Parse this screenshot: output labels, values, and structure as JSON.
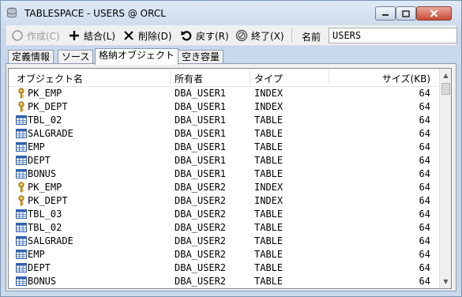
{
  "window": {
    "title": "TABLESPACE - USERS @ ORCL"
  },
  "toolbar": {
    "create_label": "作成(C)",
    "merge_label": "結合(L)",
    "delete_label": "削除(D)",
    "back_label": "戻す(R)",
    "exit_label": "終了(X)",
    "name_label": "名前",
    "name_value": "USERS"
  },
  "tabs": [
    {
      "label": "定義情報"
    },
    {
      "label": "ソース"
    },
    {
      "label": "格納オブジェクト"
    },
    {
      "label": "空き容量"
    }
  ],
  "columns": {
    "object_name": "オブジェクト名",
    "owner": "所有者",
    "type": "タイプ",
    "size": "サイズ(KB)"
  },
  "rows": [
    {
      "icon": "key-icon",
      "name": "PK_EMP",
      "owner": "DBA_USER1",
      "type": "INDEX",
      "size": "64"
    },
    {
      "icon": "key-icon",
      "name": "PK_DEPT",
      "owner": "DBA_USER1",
      "type": "INDEX",
      "size": "64"
    },
    {
      "icon": "table-icon",
      "name": "TBL_02",
      "owner": "DBA_USER1",
      "type": "TABLE",
      "size": "64"
    },
    {
      "icon": "table-icon",
      "name": "SALGRADE",
      "owner": "DBA_USER1",
      "type": "TABLE",
      "size": "64"
    },
    {
      "icon": "table-icon",
      "name": "EMP",
      "owner": "DBA_USER1",
      "type": "TABLE",
      "size": "64"
    },
    {
      "icon": "table-icon",
      "name": "DEPT",
      "owner": "DBA_USER1",
      "type": "TABLE",
      "size": "64"
    },
    {
      "icon": "table-icon",
      "name": "BONUS",
      "owner": "DBA_USER1",
      "type": "TABLE",
      "size": "64"
    },
    {
      "icon": "key-icon",
      "name": "PK_EMP",
      "owner": "DBA_USER2",
      "type": "INDEX",
      "size": "64"
    },
    {
      "icon": "key-icon",
      "name": "PK_DEPT",
      "owner": "DBA_USER2",
      "type": "INDEX",
      "size": "64"
    },
    {
      "icon": "table-icon",
      "name": "TBL_03",
      "owner": "DBA_USER2",
      "type": "TABLE",
      "size": "64"
    },
    {
      "icon": "table-icon",
      "name": "TBL_02",
      "owner": "DBA_USER2",
      "type": "TABLE",
      "size": "64"
    },
    {
      "icon": "table-icon",
      "name": "SALGRADE",
      "owner": "DBA_USER2",
      "type": "TABLE",
      "size": "64"
    },
    {
      "icon": "table-icon",
      "name": "EMP",
      "owner": "DBA_USER2",
      "type": "TABLE",
      "size": "64"
    },
    {
      "icon": "table-icon",
      "name": "DEPT",
      "owner": "DBA_USER2",
      "type": "TABLE",
      "size": "64"
    },
    {
      "icon": "table-icon",
      "name": "BONUS",
      "owner": "DBA_USER2",
      "type": "TABLE",
      "size": "64"
    }
  ],
  "colors": {
    "titlebar": "#c9d9ec",
    "key_icon": "#d9a520",
    "table_icon": "#2e63b0",
    "close_button": "#c74a33"
  }
}
